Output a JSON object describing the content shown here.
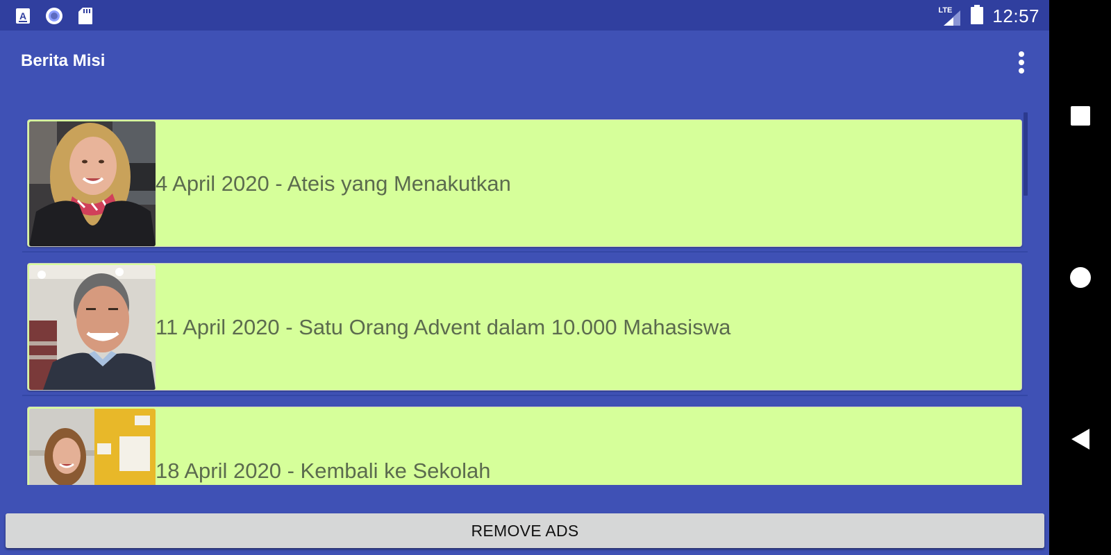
{
  "status_bar": {
    "time": "12:57",
    "network_label": "LTE",
    "left_icons": [
      "font-notification-icon",
      "circle-notification-icon",
      "sd-card-icon"
    ],
    "right_icons": [
      "lte-signal-icon",
      "battery-icon"
    ],
    "color": "#303F9F"
  },
  "app_bar": {
    "title": "Berita Misi",
    "overflow_icon": "more-vert-icon",
    "color": "#3F51B5"
  },
  "articles": [
    {
      "title": "4 April 2020 - Ateis yang Menakutkan",
      "thumbnail": "woman-blonde-portrait"
    },
    {
      "title": "11 April 2020 - Satu Orang Advent dalam 10.000 Mahasiswa",
      "thumbnail": "man-smiling-portrait"
    },
    {
      "title": "18 April 2020 - Kembali ke Sekolah",
      "thumbnail": "woman-yellow-door-portrait"
    }
  ],
  "card_color": "#D6FF9A",
  "card_text_color": "#5B6B4E",
  "remove_ads_button": {
    "label": "REMOVE ADS"
  },
  "nav_bar": {
    "buttons": [
      "recents-square-icon",
      "home-circle-icon",
      "back-triangle-icon"
    ]
  }
}
